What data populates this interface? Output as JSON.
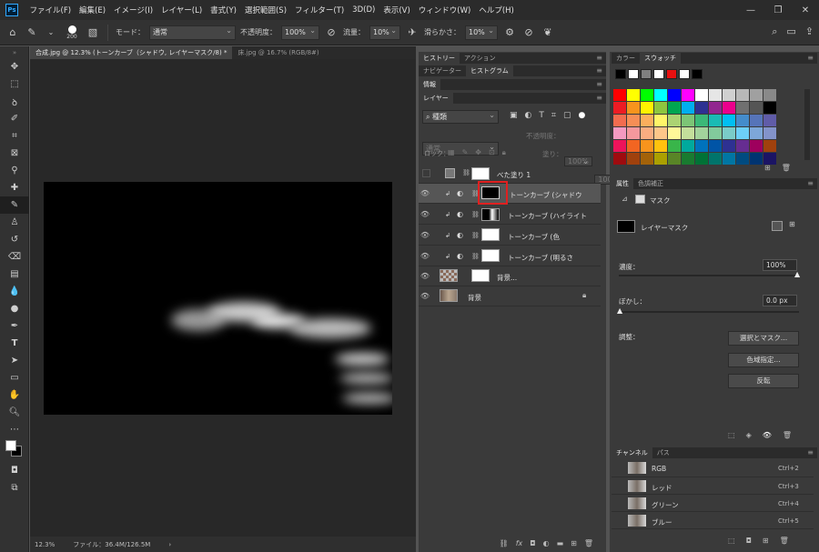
{
  "menu": [
    "ファイル(F)",
    "編集(E)",
    "イメージ(I)",
    "レイヤー(L)",
    "書式(Y)",
    "選択範囲(S)",
    "フィルター(T)",
    "3D(D)",
    "表示(V)",
    "ウィンドウ(W)",
    "ヘルプ(H)"
  ],
  "app_logo": "Ps",
  "options": {
    "brush_size": "200",
    "mode_label": "モード：",
    "mode_value": "通常",
    "opacity_label": "不透明度：",
    "opacity_value": "100%",
    "flow_label": "流量：",
    "flow_value": "10%",
    "smoothing_label": "滑らかさ：",
    "smoothing_value": "10%"
  },
  "doc_tabs": [
    {
      "label": "合成.jpg @ 12.3% (トーンカーブ（シャドウ, レイヤーマスク/8) *",
      "active": true
    },
    {
      "label": "床.jpg @ 16.7% (RGB/8#)",
      "active": false
    }
  ],
  "status": {
    "zoom": "12.3%",
    "file": "ファイル：36.4M/126.5M"
  },
  "panels": {
    "history_tabs": [
      "ヒストリー",
      "アクション"
    ],
    "navigator_tabs": [
      "ナビゲーター",
      "ヒストグラム"
    ],
    "info_tab": "情報",
    "layers_tab": "レイヤー",
    "color_tabs": [
      "カラー",
      "スウォッチ"
    ],
    "properties_tabs": [
      "属性",
      "色調補正"
    ],
    "channels_tabs": [
      "チャンネル",
      "パス"
    ]
  },
  "layers": {
    "filter_kind": "種類",
    "blend_mode": "通常",
    "opacity_label": "不透明度：",
    "opacity_value": "100%",
    "lock_label": "ロック：",
    "fill_label": "塗り：",
    "fill_value": "100%",
    "items": [
      {
        "name": "べた塗り 1"
      },
      {
        "name": "トーンカーブ (シャドウ"
      },
      {
        "name": "トーンカーブ (ハイライト"
      },
      {
        "name": "トーンカーブ (色"
      },
      {
        "name": "トーンカーブ (明るさ"
      },
      {
        "name": "背景..."
      },
      {
        "name": "背景"
      }
    ]
  },
  "properties": {
    "mask_title": "マスク",
    "layer_mask_label": "レイヤーマスク",
    "density_label": "濃度：",
    "density_value": "100%",
    "feather_label": "ぼかし：",
    "feather_value": "0.0 px",
    "adjust_label": "調整：",
    "select_mask_btn": "選択とマスク...",
    "color_range_btn": "色域指定...",
    "invert_btn": "反転",
    "density_level": 1.0,
    "feather_level": 0.0
  },
  "channels": [
    {
      "name": "RGB",
      "key": "Ctrl+2"
    },
    {
      "name": "レッド",
      "key": "Ctrl+3"
    },
    {
      "name": "グリーン",
      "key": "Ctrl+4"
    },
    {
      "name": "ブルー",
      "key": "Ctrl+5"
    }
  ],
  "swatch_top": [
    "#000000",
    "#ffffff",
    "#7f7f7f",
    "#ffffff",
    "#e81010",
    "#ffffff",
    "#000000"
  ],
  "swatches": [
    "#ff0000",
    "#ffff00",
    "#00ff00",
    "#00ffff",
    "#0000ff",
    "#ff00ff",
    "#ffffff",
    "#e6e6e6",
    "#d0d0d0",
    "#b8b8b8",
    "#a0a0a0",
    "#898989",
    "#ed1c24",
    "#f7941d",
    "#fff200",
    "#8dc63f",
    "#00a651",
    "#00aeef",
    "#2e3192",
    "#92278f",
    "#ec008c",
    "#707070",
    "#555555",
    "#000000",
    "#f26c4f",
    "#f68e56",
    "#fbaf5d",
    "#fff568",
    "#acd373",
    "#7cc576",
    "#3bb878",
    "#1abbb4",
    "#00bff3",
    "#448ccb",
    "#5674b9",
    "#605ca8",
    "#f49ac1",
    "#f5989d",
    "#f9ad81",
    "#fdc689",
    "#fff799",
    "#c4df9b",
    "#a3d39c",
    "#82ca9c",
    "#7accc8",
    "#6dcff6",
    "#7da7d9",
    "#8393ca",
    "#ed145b",
    "#f26522",
    "#f7941d",
    "#ffc20e",
    "#39b54a",
    "#00a99d",
    "#0072bc",
    "#0054a6",
    "#2e3192",
    "#662d91",
    "#9e005d",
    "#a0410d",
    "#9e0b0f",
    "#a0410d",
    "#a36209",
    "#aba000",
    "#598527",
    "#197b30",
    "#007236",
    "#00746b",
    "#0076a3",
    "#004b80",
    "#003471",
    "#1b1464"
  ]
}
